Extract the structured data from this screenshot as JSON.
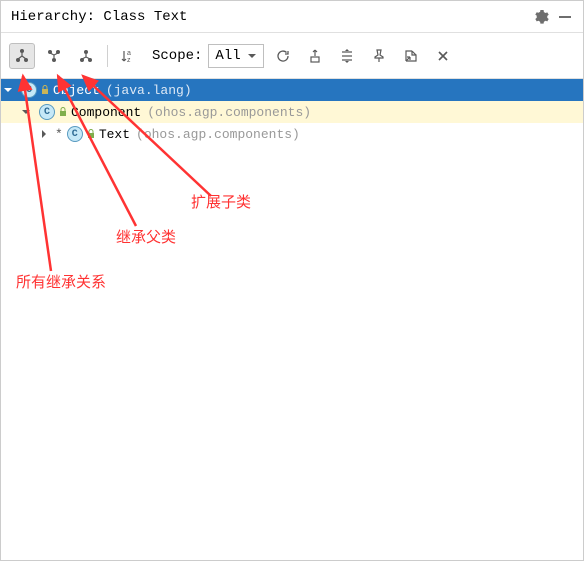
{
  "header": {
    "title": "Hierarchy: Class Text"
  },
  "toolbar": {
    "scope_label": "Scope:",
    "scope_value": "All"
  },
  "tree": {
    "rows": [
      {
        "name": "Object",
        "pkg": "(java.lang)"
      },
      {
        "name": "Component",
        "pkg": "(ohos.agp.components)"
      },
      {
        "name": "Text",
        "pkg": "(ohos.agp.components)"
      }
    ]
  },
  "annotations": {
    "a1": "扩展子类",
    "a2": "继承父类",
    "a3": "所有继承关系"
  }
}
